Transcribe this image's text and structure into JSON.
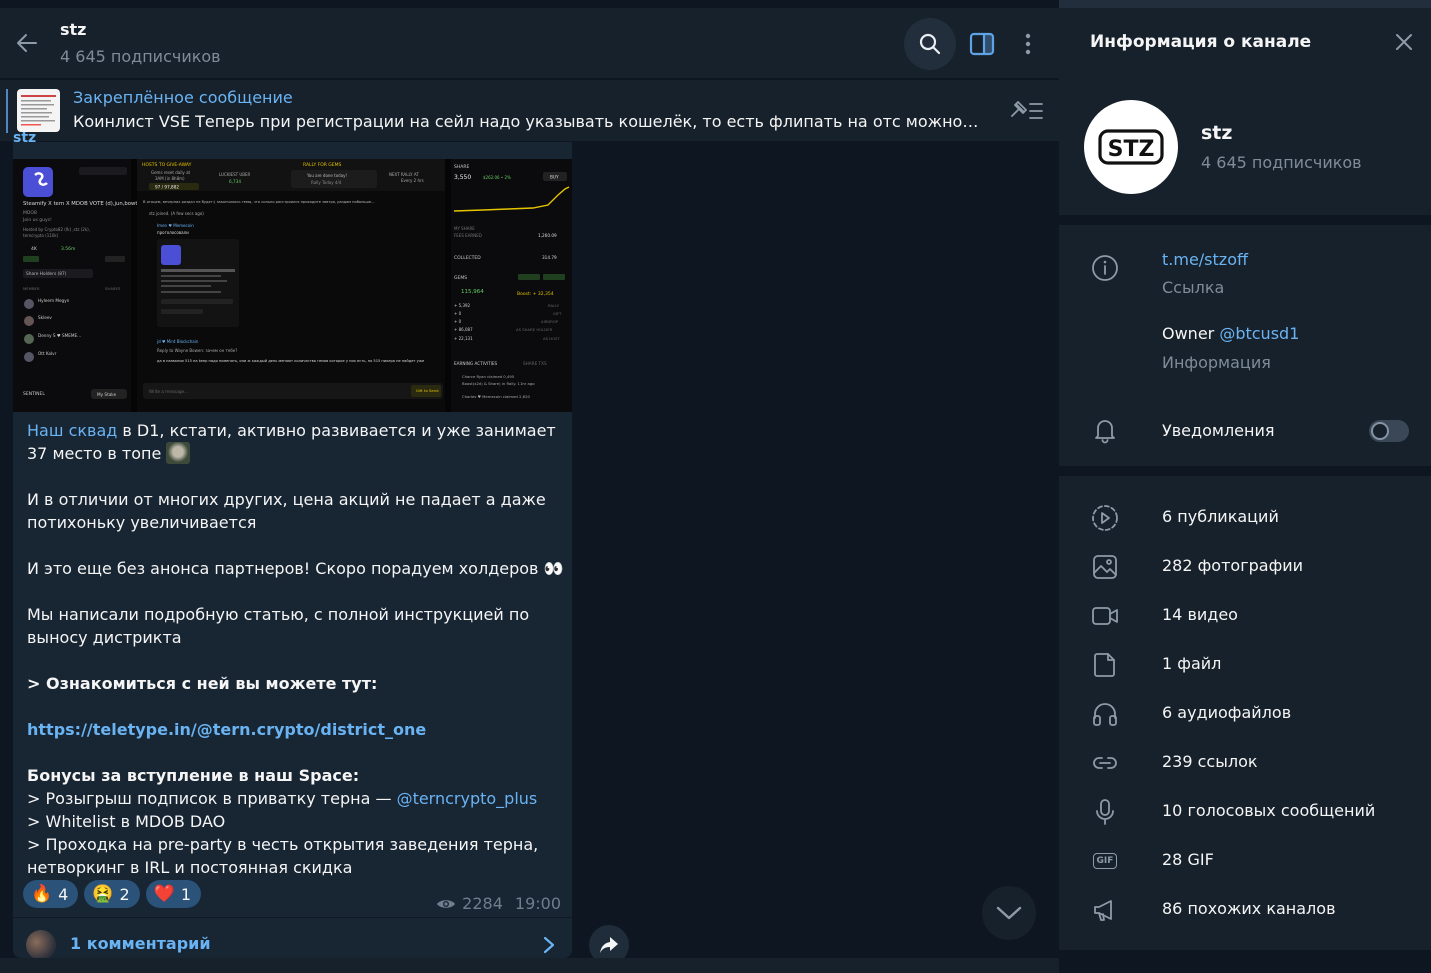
{
  "header": {
    "title": "stz",
    "subscribers": "4 645 подписчиков"
  },
  "pinned": {
    "title": "Закреплённое сообщение",
    "text": "Коинлист VSE  Теперь при регистрации на сейл надо указывать кошелёк, то есть флипать на отс можно буд..."
  },
  "message": {
    "author": "stz",
    "paragraphs": {
      "p1_link": "Наш сквад",
      "p1_text": " в D1, кстати, активно развивается и уже занимает 37 место в топе",
      "p2": "И в отличии от многих других, цена акций не падает а даже потихоньку увеличивается",
      "p3": "И это еще без анонса партнеров! Скоро порадуем холдеров 👀",
      "p4": "Мы написали подробную статью, с полной инструкцией по выносу дистрикта",
      "p5": "> Ознакомиться с ней вы можете тут:",
      "p6_link": "https://teletype.in/@tern.crypto/district_one",
      "p7_title": "Бонусы за вступление в наш Space:",
      "p7_l1": "> Розыгрыш подписок в приватку терна — ",
      "p7_l1_link": "@terncrypto_plus",
      "p7_l2": "> Whitelist в MDOB DAO",
      "p7_l3": "> Проходка на pre-party в честь открытия заведения терна, нетворкинг в IRL и постоянная скидка"
    },
    "reactions": [
      {
        "emoji": "🔥",
        "count": "4"
      },
      {
        "emoji": "🤮",
        "count": "2"
      },
      {
        "emoji": "❤️",
        "count": "1"
      }
    ],
    "views": "2284",
    "time": "19:00",
    "comments": "1 комментарий"
  },
  "photo": {
    "left_panel": {
      "title": "Steamify X tern X MDOB VOTE (d),jun,bowt,blaster,gold,515,lar",
      "sub1": "MDOB",
      "sub2": "Join us guys!",
      "host": "Hosted by Crypto82 (fk) ,stz (2k),",
      "host2": "terncrypto (110k)",
      "stat1": "4K",
      "stat2": "3.56m",
      "holders": "Share Holders (87)",
      "members": "MEMBER",
      "shares": "SHARES",
      "m1": "Hyleem Megyn",
      "m2": "Skleev",
      "m3": "Denny S ♥ SMEME...",
      "m4": "Ott Kolvr",
      "sentinel": "SENTINEL",
      "mystake": "My Stake"
    },
    "middle_panel": {
      "hosts": "HOSTS TO GIVE-AWAY",
      "rally": "RALLY FOR GEMS",
      "gems_reset": "Gems reset daily at",
      "gems_time": "3AM (in 8h8m)",
      "gems_val": "97 / 97,882",
      "luckiest": "LUCKIEST UBER",
      "luckiest_val": "6,734",
      "done": "You are done today!",
      "rally_today": "Rally Today 4/4",
      "next_rally": "NEXT RALLY AT",
      "every": "Every 2 hrs",
      "post1": "В отоцем, вечерних раздач не будет:( закончились гемы, что сильно расстроился приходите завтра, раздам побольше...",
      "joined": "stz joined. (A few secs ago)",
      "author2": "Imen ♥ Memecoin",
      "msg2": "проголосовали",
      "author3": "jd ♥ Mint Blockchain",
      "reply": "Reply to Wayne Bowen: зачем он тебе?",
      "msg3": "да в названии 515 на keep надо поменять, они ж каждый день меняют количество гемов которое у них есть, по 515 никера не найдет уже",
      "write": "Write a message...",
      "gift": "Gift to Send"
    },
    "right_panel": {
      "share": "SHARE",
      "share_val": "3,550",
      "share_delta": "$262.06 • 2%",
      "buy": "BUY",
      "my_share": "MY SHARE",
      "fees": "FEES EARNED",
      "fees_val": "1,260.09",
      "collected": "COLLECTED",
      "collected_val": "314.79",
      "gems": "GEMS",
      "gems_val": "115,964",
      "boost": "Boost: + 32,354",
      "l1": "+ 5,392",
      "r1": "RALLY",
      "l2": "+ 0",
      "r2": "GIFT",
      "l3": "+ 0",
      "r3": "AIRDROP",
      "l4": "+ 86,087",
      "r4": "AS SHARE HOLDER",
      "l5": "+ 22,131",
      "r5": "AS HOST",
      "earning": "EARNING ACTIVITIES",
      "sharetxs": "SHARE TXS",
      "e1": "Charce Ryan claimed 0,495",
      "e2": "Boost(x2d) & Share) in Rally. 11hr ago",
      "e3": "Charles ♥ Memecoin claimed 2,620"
    }
  },
  "info": {
    "title": "Информация о канале",
    "channel_name": "stz",
    "subscribers": "4 645 подписчиков",
    "link": "t.me/stzoff",
    "link_label": "Ссылка",
    "owner_prefix": "Owner ",
    "owner_handle": "@btcusd1",
    "info_label": "Информация",
    "notifications": "Уведомления",
    "media": [
      {
        "icon": "publications-icon",
        "label": "6 публикаций"
      },
      {
        "icon": "photo-icon",
        "label": "282 фотографии"
      },
      {
        "icon": "video-icon",
        "label": "14 видео"
      },
      {
        "icon": "file-icon",
        "label": "1 файл"
      },
      {
        "icon": "headphones-icon",
        "label": "6 аудиофайлов"
      },
      {
        "icon": "link-icon",
        "label": "239 ссылок"
      },
      {
        "icon": "microphone-icon",
        "label": "10 голосовых сообщений"
      },
      {
        "icon": "gif-icon",
        "label": "28 GIF"
      },
      {
        "icon": "megaphone-icon",
        "label": "86 похожих каналов"
      }
    ],
    "gif_icon_text": "GIF",
    "avatar_logo": "STZ"
  },
  "colors": {
    "bg": "#0e1621",
    "panel": "#17212b",
    "bubble": "#182533",
    "accent": "#6ab3f3",
    "muted": "#7f8b98"
  }
}
